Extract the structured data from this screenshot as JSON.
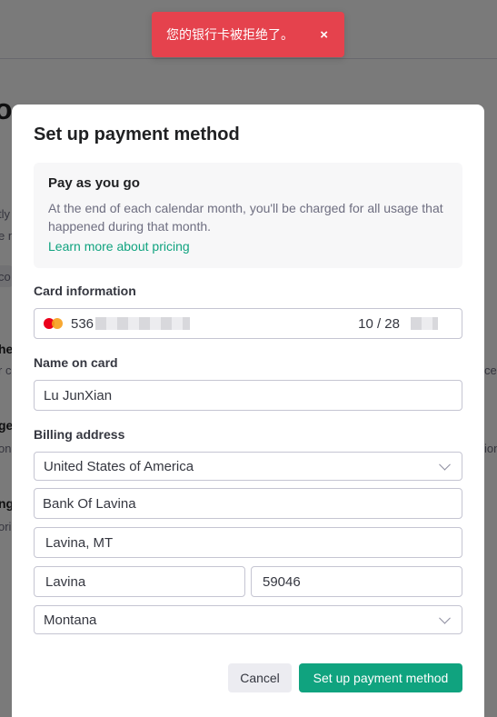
{
  "background": {
    "title_fragment": "o",
    "fragments": [
      "tly",
      "e n",
      "co",
      "he",
      "r c",
      "ge",
      "on",
      "ng",
      "ori",
      "ce",
      "ion"
    ]
  },
  "toast": {
    "message": "您的银行卡被拒绝了。",
    "close_glyph": "×",
    "color": "#e5424d"
  },
  "modal": {
    "title": "Set up payment method",
    "info": {
      "heading": "Pay as you go",
      "description": "At the end of each calendar month, you'll be charged for all usage that happened during that month.",
      "link": "Learn more about pricing"
    },
    "card": {
      "label": "Card information",
      "brand_icon": "mastercard-icon",
      "number_prefix": "536",
      "expiry": "10 / 28"
    },
    "name": {
      "label": "Name on card",
      "value": "Lu JunXian"
    },
    "billing": {
      "label": "Billing address",
      "country": "United States of America",
      "line1": "Bank Of Lavina",
      "line2": "Lavina, MT",
      "city": "Lavina",
      "postal": "59046",
      "state": "Montana"
    },
    "buttons": {
      "cancel": "Cancel",
      "submit": "Set up payment method"
    },
    "accent": "#10a37f"
  }
}
